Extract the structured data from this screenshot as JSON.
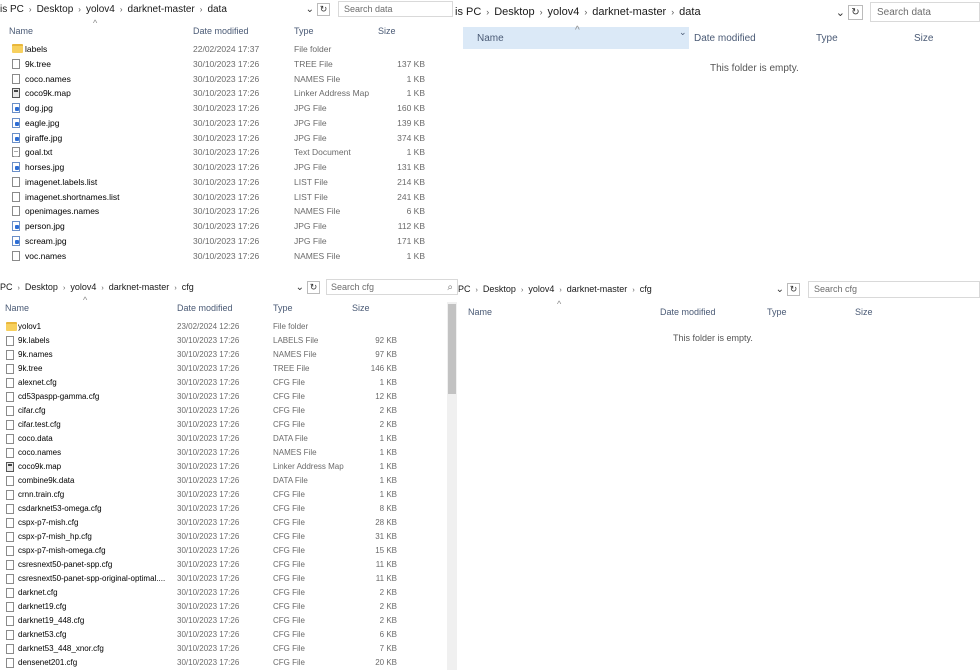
{
  "pane_top_left": {
    "breadcrumb": [
      "is PC",
      "Desktop",
      "yolov4",
      "darknet-master",
      "data"
    ],
    "search_placeholder": "Search data",
    "columns": {
      "name": "Name",
      "date": "Date modified",
      "type": "Type",
      "size": "Size"
    },
    "files": [
      {
        "name": "labels",
        "date": "22/02/2024 17:37",
        "type": "File folder",
        "size": "",
        "icon": "folder"
      },
      {
        "name": "9k.tree",
        "date": "30/10/2023 17:26",
        "type": "TREE File",
        "size": "137 KB",
        "icon": "file"
      },
      {
        "name": "coco.names",
        "date": "30/10/2023 17:26",
        "type": "NAMES File",
        "size": "1 KB",
        "icon": "file"
      },
      {
        "name": "coco9k.map",
        "date": "30/10/2023 17:26",
        "type": "Linker Address Map",
        "size": "1 KB",
        "icon": "map"
      },
      {
        "name": "dog.jpg",
        "date": "30/10/2023 17:26",
        "type": "JPG File",
        "size": "160 KB",
        "icon": "img"
      },
      {
        "name": "eagle.jpg",
        "date": "30/10/2023 17:26",
        "type": "JPG File",
        "size": "139 KB",
        "icon": "img"
      },
      {
        "name": "giraffe.jpg",
        "date": "30/10/2023 17:26",
        "type": "JPG File",
        "size": "374 KB",
        "icon": "img"
      },
      {
        "name": "goal.txt",
        "date": "30/10/2023 17:26",
        "type": "Text Document",
        "size": "1 KB",
        "icon": "txt"
      },
      {
        "name": "horses.jpg",
        "date": "30/10/2023 17:26",
        "type": "JPG File",
        "size": "131 KB",
        "icon": "img"
      },
      {
        "name": "imagenet.labels.list",
        "date": "30/10/2023 17:26",
        "type": "LIST File",
        "size": "214 KB",
        "icon": "file"
      },
      {
        "name": "imagenet.shortnames.list",
        "date": "30/10/2023 17:26",
        "type": "LIST File",
        "size": "241 KB",
        "icon": "file"
      },
      {
        "name": "openimages.names",
        "date": "30/10/2023 17:26",
        "type": "NAMES File",
        "size": "6 KB",
        "icon": "file"
      },
      {
        "name": "person.jpg",
        "date": "30/10/2023 17:26",
        "type": "JPG File",
        "size": "112 KB",
        "icon": "img"
      },
      {
        "name": "scream.jpg",
        "date": "30/10/2023 17:26",
        "type": "JPG File",
        "size": "171 KB",
        "icon": "img"
      },
      {
        "name": "voc.names",
        "date": "30/10/2023 17:26",
        "type": "NAMES File",
        "size": "1 KB",
        "icon": "file"
      }
    ]
  },
  "pane_top_right": {
    "breadcrumb": [
      "is PC",
      "Desktop",
      "yolov4",
      "darknet-master",
      "data"
    ],
    "search_placeholder": "Search data",
    "columns": {
      "name": "Name",
      "date": "Date modified",
      "type": "Type",
      "size": "Size"
    },
    "empty_message": "This folder is empty."
  },
  "pane_bottom_left": {
    "breadcrumb": [
      "PC",
      "Desktop",
      "yolov4",
      "darknet-master",
      "cfg"
    ],
    "search_placeholder": "Search cfg",
    "columns": {
      "name": "Name",
      "date": "Date modified",
      "type": "Type",
      "size": "Size"
    },
    "files": [
      {
        "name": "yolov1",
        "date": "23/02/2024 12:26",
        "type": "File folder",
        "size": "",
        "icon": "folder"
      },
      {
        "name": "9k.labels",
        "date": "30/10/2023 17:26",
        "type": "LABELS File",
        "size": "92 KB",
        "icon": "file"
      },
      {
        "name": "9k.names",
        "date": "30/10/2023 17:26",
        "type": "NAMES File",
        "size": "97 KB",
        "icon": "file"
      },
      {
        "name": "9k.tree",
        "date": "30/10/2023 17:26",
        "type": "TREE File",
        "size": "146 KB",
        "icon": "file"
      },
      {
        "name": "alexnet.cfg",
        "date": "30/10/2023 17:26",
        "type": "CFG File",
        "size": "1 KB",
        "icon": "file"
      },
      {
        "name": "cd53paspp-gamma.cfg",
        "date": "30/10/2023 17:26",
        "type": "CFG File",
        "size": "12 KB",
        "icon": "file"
      },
      {
        "name": "cifar.cfg",
        "date": "30/10/2023 17:26",
        "type": "CFG File",
        "size": "2 KB",
        "icon": "file"
      },
      {
        "name": "cifar.test.cfg",
        "date": "30/10/2023 17:26",
        "type": "CFG File",
        "size": "2 KB",
        "icon": "file"
      },
      {
        "name": "coco.data",
        "date": "30/10/2023 17:26",
        "type": "DATA File",
        "size": "1 KB",
        "icon": "file"
      },
      {
        "name": "coco.names",
        "date": "30/10/2023 17:26",
        "type": "NAMES File",
        "size": "1 KB",
        "icon": "file"
      },
      {
        "name": "coco9k.map",
        "date": "30/10/2023 17:26",
        "type": "Linker Address Map",
        "size": "1 KB",
        "icon": "map"
      },
      {
        "name": "combine9k.data",
        "date": "30/10/2023 17:26",
        "type": "DATA File",
        "size": "1 KB",
        "icon": "file"
      },
      {
        "name": "crnn.train.cfg",
        "date": "30/10/2023 17:26",
        "type": "CFG File",
        "size": "1 KB",
        "icon": "file"
      },
      {
        "name": "csdarknet53-omega.cfg",
        "date": "30/10/2023 17:26",
        "type": "CFG File",
        "size": "8 KB",
        "icon": "file"
      },
      {
        "name": "cspx-p7-mish.cfg",
        "date": "30/10/2023 17:26",
        "type": "CFG File",
        "size": "28 KB",
        "icon": "file"
      },
      {
        "name": "cspx-p7-mish_hp.cfg",
        "date": "30/10/2023 17:26",
        "type": "CFG File",
        "size": "31 KB",
        "icon": "file"
      },
      {
        "name": "cspx-p7-mish-omega.cfg",
        "date": "30/10/2023 17:26",
        "type": "CFG File",
        "size": "15 KB",
        "icon": "file"
      },
      {
        "name": "csresnext50-panet-spp.cfg",
        "date": "30/10/2023 17:26",
        "type": "CFG File",
        "size": "11 KB",
        "icon": "file"
      },
      {
        "name": "csresnext50-panet-spp-original-optimal....",
        "date": "30/10/2023 17:26",
        "type": "CFG File",
        "size": "11 KB",
        "icon": "file"
      },
      {
        "name": "darknet.cfg",
        "date": "30/10/2023 17:26",
        "type": "CFG File",
        "size": "2 KB",
        "icon": "file"
      },
      {
        "name": "darknet19.cfg",
        "date": "30/10/2023 17:26",
        "type": "CFG File",
        "size": "2 KB",
        "icon": "file"
      },
      {
        "name": "darknet19_448.cfg",
        "date": "30/10/2023 17:26",
        "type": "CFG File",
        "size": "2 KB",
        "icon": "file"
      },
      {
        "name": "darknet53.cfg",
        "date": "30/10/2023 17:26",
        "type": "CFG File",
        "size": "6 KB",
        "icon": "file"
      },
      {
        "name": "darknet53_448_xnor.cfg",
        "date": "30/10/2023 17:26",
        "type": "CFG File",
        "size": "7 KB",
        "icon": "file"
      },
      {
        "name": "densenet201.cfg",
        "date": "30/10/2023 17:26",
        "type": "CFG File",
        "size": "20 KB",
        "icon": "file"
      }
    ]
  },
  "pane_bottom_right": {
    "breadcrumb": [
      "PC",
      "Desktop",
      "yolov4",
      "darknet-master",
      "cfg"
    ],
    "search_placeholder": "Search cfg",
    "columns": {
      "name": "Name",
      "date": "Date modified",
      "type": "Type",
      "size": "Size"
    },
    "empty_message": "This folder is empty."
  },
  "icons": {
    "breadcrumb_separator": "›",
    "dropdown": "⌄",
    "refresh": "↻",
    "sort_up": "^",
    "search": "⌕"
  },
  "colors": {
    "selected_header": "#dbe9f7",
    "folder": "#f7d05e",
    "header_text": "#4a5a75"
  }
}
